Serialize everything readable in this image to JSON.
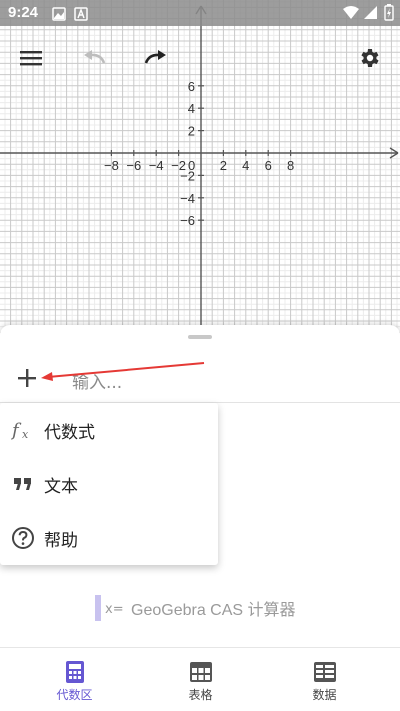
{
  "status_bar": {
    "time": "9:24"
  },
  "graph": {
    "x_ticks": [
      "−8",
      "−6",
      "−4",
      "−2",
      "0",
      "2",
      "4",
      "6",
      "8"
    ],
    "y_ticks_positive": [
      "6",
      "4",
      "2"
    ],
    "y_ticks_negative": [
      "−2",
      "−4",
      "−6"
    ],
    "axis_color": "#555555",
    "grid_major_color": "#c9c9c9",
    "grid_minor_color": "#ececec"
  },
  "toolbar": {
    "menu_icon": "hamburger-menu-icon",
    "undo_icon": "undo-icon",
    "redo_icon": "redo-icon",
    "settings_icon": "gear-icon"
  },
  "algebra": {
    "input_placeholder": "输入...",
    "add_icon": "plus-icon",
    "annotation_color": "#e53935"
  },
  "add_menu": {
    "items": [
      {
        "label": "代数式",
        "icon": "fx-icon"
      },
      {
        "label": "文本",
        "icon": "quote-icon"
      },
      {
        "label": "帮助",
        "icon": "help-circle-icon"
      }
    ]
  },
  "cas_promo": {
    "text": "GeoGebra CAS 计算器",
    "accent": "#c8c2ef"
  },
  "bottom_nav": {
    "accent": "#6557d2",
    "items": [
      {
        "label": "代数区",
        "icon": "calculator-icon",
        "active": true
      },
      {
        "label": "表格",
        "icon": "table-icon",
        "active": false
      },
      {
        "label": "数据",
        "icon": "data-icon",
        "active": false
      }
    ]
  }
}
